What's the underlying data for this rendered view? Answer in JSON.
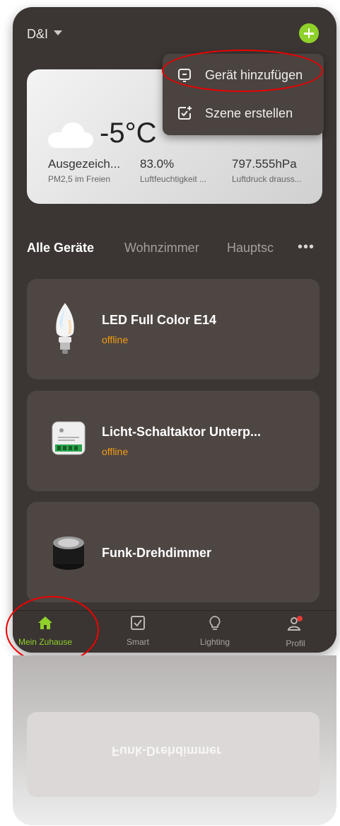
{
  "header": {
    "home_name": "D&I"
  },
  "popup_menu": {
    "items": [
      {
        "label": "Gerät hinzufügen"
      },
      {
        "label": "Szene erstellen"
      }
    ]
  },
  "weather": {
    "temperature": "-5°C",
    "stats": [
      {
        "value": "Ausgezeich...",
        "label": "PM2,5 im Freien"
      },
      {
        "value": "83.0%",
        "label": "Luftfeuchtigkeit ..."
      },
      {
        "value": "797.555hPa",
        "label": "Luftdruck drauss..."
      }
    ]
  },
  "tabs": [
    "Alle Geräte",
    "Wohnzimmer",
    "Hauptsc"
  ],
  "devices": [
    {
      "name": "LED Full Color E14",
      "status": "offline"
    },
    {
      "name": "Licht-Schaltaktor Unterp...",
      "status": "offline"
    },
    {
      "name": "Funk-Drehdimmer",
      "status": ""
    }
  ],
  "bottom_nav": [
    {
      "label": "Mein Zuhause",
      "icon": "home-icon"
    },
    {
      "label": "Smart",
      "icon": "checkbox-icon"
    },
    {
      "label": "Lighting",
      "icon": "bulb-icon"
    },
    {
      "label": "Profil",
      "icon": "profile-icon"
    }
  ],
  "colors": {
    "accent": "#8fd12b",
    "offline": "#f39c12",
    "highlight_ring": "#e00000"
  }
}
